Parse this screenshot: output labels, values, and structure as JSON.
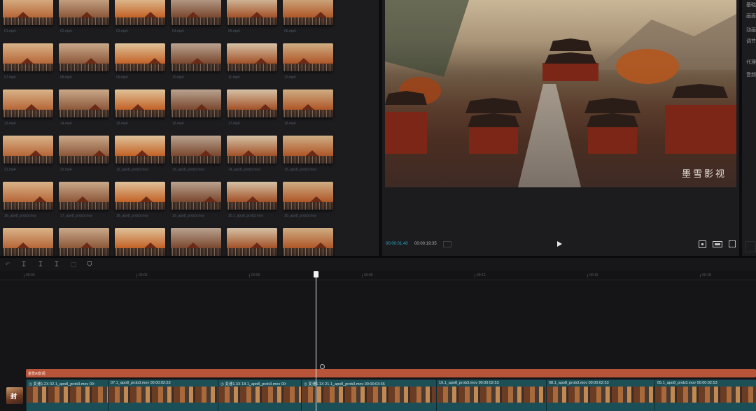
{
  "media": {
    "items": [
      {
        "name": "01.mp4"
      },
      {
        "name": "02.mp4"
      },
      {
        "name": "03.mp4"
      },
      {
        "name": "04.mp4"
      },
      {
        "name": "05.mp4"
      },
      {
        "name": "06.mp4"
      },
      {
        "name": "07.mp4"
      },
      {
        "name": "08.mp4"
      },
      {
        "name": "09.mp4"
      },
      {
        "name": "10.mp4"
      },
      {
        "name": "11.mp4"
      },
      {
        "name": "12.mp4"
      },
      {
        "name": "13.mp4"
      },
      {
        "name": "14.mp4"
      },
      {
        "name": "15.mp4"
      },
      {
        "name": "16.mp4"
      },
      {
        "name": "17.mp4"
      },
      {
        "name": "18.mp4"
      },
      {
        "name": "21.mp4"
      },
      {
        "name": "22.mp4"
      },
      {
        "name": "12_apo8_prob3.mov"
      },
      {
        "name": "13_apo8_prob3.mov"
      },
      {
        "name": "14_apo8_prob3.mov"
      },
      {
        "name": "15_apo8_prob3.mov"
      },
      {
        "name": "16_apo8_prob3.mov"
      },
      {
        "name": "17_apo8_prob3.mov"
      },
      {
        "name": "18_apo8_prob3.mov"
      },
      {
        "name": "19_apo8_prob3.mov"
      },
      {
        "name": "20.1_apo8_prob3.mov"
      },
      {
        "name": "20_apo8_prob3.mov"
      },
      {
        "name": ""
      },
      {
        "name": ""
      },
      {
        "name": ""
      },
      {
        "name": ""
      },
      {
        "name": ""
      },
      {
        "name": ""
      }
    ]
  },
  "player": {
    "current_time": "00:00:01:40",
    "total_time": "00:00:19:35",
    "watermark": "墨雪影视"
  },
  "props": {
    "labels": [
      "基础",
      "画面",
      "动画",
      "调节",
      "代理",
      "音频"
    ]
  },
  "toolbar": {
    "tools": [
      "↶",
      "⌶",
      "⌶",
      "⌶",
      "▢",
      "⛉"
    ]
  },
  "ruler": {
    "ticks": [
      "00:00",
      "00:03",
      "00:06",
      "00:09",
      "00:12",
      "00:15",
      "00:18"
    ]
  },
  "timeline": {
    "text_track_label": "墨雪AI影视",
    "cover_label": "封",
    "clips": [
      {
        "label": "◷ 变速1.2X  02.1_apo8_prob3.mov  00:"
      },
      {
        "label": "07.1_apo8_prob3.mov  00:00:02:53"
      },
      {
        "label": "◷ 变速1.3X  18.1_apo8_prob3.mov  00:"
      },
      {
        "label": "◷ 变速1.1X  21.1_apo8_prob3.mov  00:00:03:36"
      },
      {
        "label": "19.1_apo8_prob3.mov  00:00:02:53"
      },
      {
        "label": "08.1_apo8_prob3.mov  00:00:02:53"
      },
      {
        "label": "05.1_apo8_prob3.mov  00:00:02:53"
      }
    ]
  }
}
